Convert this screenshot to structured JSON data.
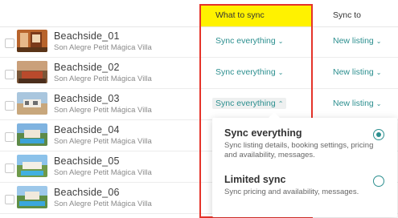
{
  "header": {
    "what_to_sync": "What to sync",
    "sync_to": "Sync to"
  },
  "listings": [
    {
      "title": "Beachside_01",
      "subtitle": "Son Alegre Petit Mágica Villa",
      "what_to_sync": "Sync everything",
      "sync_to": "New listing"
    },
    {
      "title": "Beachside_02",
      "subtitle": "Son Alegre Petit Mágica Villa",
      "what_to_sync": "Sync everything",
      "sync_to": "New listing"
    },
    {
      "title": "Beachside_03",
      "subtitle": "Son Alegre Petit Mágica Villa",
      "what_to_sync": "Sync everything",
      "sync_to": "New listing"
    },
    {
      "title": "Beachside_04",
      "subtitle": "Son Alegre Petit Mágica Villa"
    },
    {
      "title": "Beachside_05",
      "subtitle": "Son Alegre Petit Mágica Villa"
    },
    {
      "title": "Beachside_06",
      "subtitle": "Son Alegre Petit Mágica Villa"
    }
  ],
  "dropdown": {
    "options": [
      {
        "title": "Sync everything",
        "desc": "Sync listing details, booking settings, pricing and availability, messages.",
        "selected": true
      },
      {
        "title": "Limited sync",
        "desc": "Sync pricing and availability, messages.",
        "selected": false
      }
    ]
  },
  "colors": {
    "accent": "#2c8f8f",
    "highlight_border": "#e5332a",
    "highlight_fill": "#fff200"
  }
}
